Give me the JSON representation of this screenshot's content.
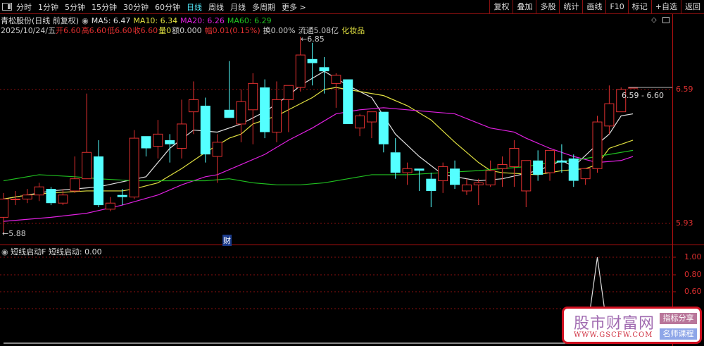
{
  "toolbar": {
    "periods": [
      "分时",
      "1分钟",
      "5分钟",
      "15分钟",
      "30分钟",
      "60分钟",
      "日线",
      "周线",
      "月线",
      "多周期",
      "更多 >"
    ],
    "active_period": "日线",
    "right_buttons": [
      "复权",
      "叠加",
      "多股",
      "统计",
      "画线",
      "F10",
      "标记",
      "+自选",
      "返回"
    ]
  },
  "info": {
    "title": "青松股份(日线 前复权)",
    "ma5": "MA5: 6.47",
    "ma10": "MA10: 6.34",
    "ma20": "MA20: 6.26",
    "ma60": "MA60: 6.29",
    "date": "2025/10/24/五",
    "open": "开6.60",
    "high": "高6.60",
    "low": "低6.60",
    "close": "收6.60",
    "volume": "量0",
    "amount": "额0.000",
    "change": "幅0.01(0.15%)",
    "turnover": "换0.00%",
    "float": "流通5.08亿",
    "sector": "化妆品"
  },
  "colors": {
    "up": "#e03030",
    "down": "#54ffff",
    "ma5": "#e0e0e0",
    "ma10": "#e0e040",
    "ma20": "#e020e0",
    "ma60": "#20c020",
    "axis": "#b01010"
  },
  "annotations": {
    "high_label": "6.85",
    "low_label": "5.88",
    "range_label": "6.59 - 6.60",
    "finance_marker": "财"
  },
  "chart_data": [
    {
      "type": "candlestick",
      "yticks": [
        "6.59",
        "5.93"
      ],
      "ylim": [
        5.86,
        6.88
      ],
      "ohlc": [
        [
          5.96,
          6.08,
          5.88,
          6.05
        ],
        [
          6.05,
          6.09,
          6.02,
          6.05
        ],
        [
          6.05,
          6.1,
          6.03,
          6.07
        ],
        [
          6.07,
          6.13,
          6.04,
          6.11
        ],
        [
          6.1,
          6.11,
          6.02,
          6.03
        ],
        [
          6.03,
          6.1,
          6.02,
          6.07
        ],
        [
          6.09,
          6.26,
          6.08,
          6.15
        ],
        [
          6.15,
          6.57,
          6.15,
          6.28
        ],
        [
          6.26,
          6.34,
          6.01,
          6.02
        ],
        [
          6.0,
          6.06,
          5.99,
          6.03
        ],
        [
          6.07,
          6.1,
          6.02,
          6.06
        ],
        [
          6.06,
          6.39,
          6.05,
          6.35
        ],
        [
          6.36,
          6.36,
          6.26,
          6.3
        ],
        [
          6.31,
          6.44,
          6.25,
          6.37
        ],
        [
          6.34,
          6.37,
          6.23,
          6.32
        ],
        [
          6.3,
          6.54,
          6.25,
          6.42
        ],
        [
          6.48,
          6.63,
          6.37,
          6.54
        ],
        [
          6.51,
          6.55,
          6.23,
          6.27
        ],
        [
          6.26,
          6.37,
          6.13,
          6.33
        ],
        [
          6.49,
          6.73,
          6.45,
          6.45
        ],
        [
          6.42,
          6.59,
          6.33,
          6.53
        ],
        [
          6.49,
          6.67,
          6.32,
          6.62
        ],
        [
          6.6,
          6.64,
          6.35,
          6.38
        ],
        [
          6.38,
          6.63,
          6.33,
          6.54
        ],
        [
          6.54,
          6.61,
          6.38,
          6.61
        ],
        [
          6.6,
          6.85,
          6.58,
          6.76
        ],
        [
          6.74,
          6.82,
          6.61,
          6.72
        ],
        [
          6.7,
          6.75,
          6.57,
          6.68
        ],
        [
          6.62,
          6.67,
          6.5,
          6.66
        ],
        [
          6.64,
          6.64,
          6.42,
          6.42
        ],
        [
          6.4,
          6.47,
          6.36,
          6.46
        ],
        [
          6.43,
          6.48,
          6.35,
          6.48
        ],
        [
          6.48,
          6.48,
          6.28,
          6.32
        ],
        [
          6.28,
          6.35,
          6.15,
          6.18
        ],
        [
          6.18,
          6.23,
          6.12,
          6.2
        ],
        [
          6.2,
          6.2,
          6.09,
          6.19
        ],
        [
          6.15,
          6.18,
          6.01,
          6.09
        ],
        [
          6.14,
          6.23,
          6.08,
          6.21
        ],
        [
          6.2,
          6.24,
          6.1,
          6.12
        ],
        [
          6.09,
          6.15,
          6.07,
          6.12
        ],
        [
          6.12,
          6.15,
          6.02,
          6.13
        ],
        [
          6.12,
          6.24,
          6.11,
          6.19
        ],
        [
          6.2,
          6.26,
          6.11,
          6.22
        ],
        [
          6.21,
          6.34,
          6.11,
          6.3
        ],
        [
          6.09,
          6.24,
          6.01,
          6.24
        ],
        [
          6.24,
          6.29,
          6.14,
          6.17
        ],
        [
          6.18,
          6.29,
          6.14,
          6.29
        ],
        [
          6.24,
          6.32,
          6.18,
          6.23
        ],
        [
          6.25,
          6.27,
          6.11,
          6.14
        ],
        [
          6.15,
          6.2,
          6.12,
          6.2
        ],
        [
          6.2,
          6.46,
          6.18,
          6.43
        ],
        [
          6.41,
          6.61,
          6.37,
          6.52
        ],
        [
          6.48,
          6.6,
          6.48,
          6.59
        ],
        [
          6.6,
          6.6,
          6.6,
          6.6
        ]
      ],
      "ma": {
        "MA5": [
          [
            0,
            6.05
          ],
          [
            4,
            6.09
          ],
          [
            8,
            6.11
          ],
          [
            12,
            6.16
          ],
          [
            14,
            6.3
          ],
          [
            16,
            6.39
          ],
          [
            18,
            6.38
          ],
          [
            20,
            6.42
          ],
          [
            22,
            6.48
          ],
          [
            24,
            6.56
          ],
          [
            25,
            6.61
          ],
          [
            27,
            6.68
          ],
          [
            29,
            6.61
          ],
          [
            31,
            6.55
          ],
          [
            33,
            6.37
          ],
          [
            35,
            6.26
          ],
          [
            37,
            6.17
          ],
          [
            40,
            6.14
          ],
          [
            42,
            6.15
          ],
          [
            45,
            6.19
          ],
          [
            47,
            6.24
          ],
          [
            48,
            6.21
          ],
          [
            50,
            6.32
          ],
          [
            51,
            6.37
          ],
          [
            52,
            6.46
          ],
          [
            53,
            6.47
          ]
        ],
        "MA10": [
          [
            0,
            6.05
          ],
          [
            2,
            6.07
          ],
          [
            4,
            6.08
          ],
          [
            7,
            6.09
          ],
          [
            10,
            6.09
          ],
          [
            11,
            6.1
          ],
          [
            13,
            6.13
          ],
          [
            15,
            6.2
          ],
          [
            17,
            6.28
          ],
          [
            19,
            6.35
          ],
          [
            20,
            6.37
          ],
          [
            21,
            6.42
          ],
          [
            23,
            6.46
          ],
          [
            25,
            6.52
          ],
          [
            26,
            6.55
          ],
          [
            27,
            6.59
          ],
          [
            28,
            6.6
          ],
          [
            30,
            6.58
          ],
          [
            32,
            6.56
          ],
          [
            34,
            6.51
          ],
          [
            36,
            6.44
          ],
          [
            38,
            6.33
          ],
          [
            40,
            6.23
          ],
          [
            41,
            6.19
          ],
          [
            42,
            6.18
          ],
          [
            45,
            6.17
          ],
          [
            47,
            6.19
          ],
          [
            49,
            6.2
          ],
          [
            50,
            6.22
          ],
          [
            51,
            6.3
          ],
          [
            53,
            6.34
          ]
        ],
        "MA20": [
          [
            0,
            5.94
          ],
          [
            4,
            5.96
          ],
          [
            7,
            5.98
          ],
          [
            10,
            6.02
          ],
          [
            13,
            6.07
          ],
          [
            15,
            6.12
          ],
          [
            17,
            6.16
          ],
          [
            18,
            6.17
          ],
          [
            20,
            6.22
          ],
          [
            22,
            6.27
          ],
          [
            24,
            6.34
          ],
          [
            26,
            6.4
          ],
          [
            28,
            6.47
          ],
          [
            30,
            6.49
          ],
          [
            32,
            6.5
          ],
          [
            34,
            6.49
          ],
          [
            36,
            6.48
          ],
          [
            38,
            6.47
          ],
          [
            41,
            6.4
          ],
          [
            43,
            6.38
          ],
          [
            44,
            6.35
          ],
          [
            46,
            6.3
          ],
          [
            48,
            6.26
          ],
          [
            50,
            6.23
          ],
          [
            52,
            6.24
          ],
          [
            53,
            6.26
          ]
        ],
        "MA60": [
          [
            0,
            6.14
          ],
          [
            3,
            6.17
          ],
          [
            6,
            6.16
          ],
          [
            8,
            6.15
          ],
          [
            11,
            6.14
          ],
          [
            17,
            6.14
          ],
          [
            19,
            6.15
          ],
          [
            21,
            6.13
          ],
          [
            23,
            6.12
          ],
          [
            25,
            6.12
          ],
          [
            27,
            6.13
          ],
          [
            29,
            6.15
          ],
          [
            31,
            6.17
          ],
          [
            34,
            6.17
          ],
          [
            37,
            6.18
          ],
          [
            40,
            6.19
          ],
          [
            42,
            6.2
          ],
          [
            44,
            6.21
          ],
          [
            46,
            6.23
          ],
          [
            48,
            6.24
          ],
          [
            50,
            6.26
          ],
          [
            52,
            6.28
          ],
          [
            53,
            6.29
          ]
        ]
      }
    },
    {
      "type": "line",
      "title": "短线启动F",
      "series_label": "短线启动: 0.00",
      "yticks": [
        "1.00",
        "0.80",
        "0.60"
      ],
      "ylim": [
        0,
        1.0
      ],
      "spike_index": 50,
      "spike_value": 1.0,
      "baseline_value": 0
    }
  ],
  "watermark": {
    "name": "股市财富网",
    "url": "WWW.GSCFW.COM",
    "tag1": "指标分享",
    "tag2": "名师课程"
  }
}
